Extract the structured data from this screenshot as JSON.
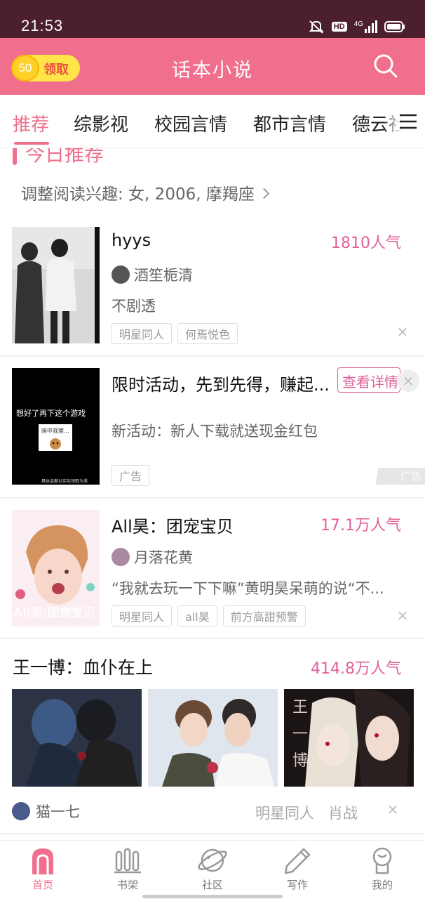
{
  "status_bar": {
    "time": "21:53",
    "hd": "HD",
    "network": "4G",
    "icons": [
      "mute-bell-icon",
      "hd-icon",
      "signal-icon",
      "battery-icon"
    ]
  },
  "header": {
    "coin_amount": "50",
    "coin_label": "领取",
    "title": "话本小说",
    "accent_color": "#f06f8c"
  },
  "tabs": [
    {
      "label": "推荐",
      "active": true
    },
    {
      "label": "综影视",
      "active": false
    },
    {
      "label": "校园言情",
      "active": false
    },
    {
      "label": "都市言情",
      "active": false
    },
    {
      "label": "德云社",
      "active": false
    }
  ],
  "section": {
    "title": "今日推荐",
    "interest": "调整阅读兴趣: 女, 2006, 摩羯座"
  },
  "books": [
    {
      "title": "hyys",
      "popularity": "1810人气",
      "author": "酒笙栀清",
      "description": "不剧透",
      "tags": [
        "明星同人",
        "何焉悦色"
      ]
    },
    {
      "title": "All昊：团宠宝贝",
      "popularity": "17.1万人气",
      "author": "月落花黄",
      "description": "“我就去玩一下下嘛”黄明昊呆萌的说“不...",
      "tags": [
        "明星同人",
        "all昊",
        "前方高甜预警"
      ],
      "cover_text": "All昊:团宠宝贝"
    }
  ],
  "ad": {
    "title": "限时活动，先到先得，赚起...",
    "button_label": "查看详情",
    "description": "新活动：新人下载就送现金红包",
    "tag": "广告",
    "badge": "广告",
    "cover_text": "想好了再下这个游戏",
    "cover_sub": "暗中观察...",
    "cover_note": "具体金额以实际领取为准"
  },
  "featured": {
    "title": "王一博：血仆在上",
    "popularity": "414.8万人气",
    "author": "猫一七",
    "tags": [
      "明星同人",
      "肖战"
    ],
    "image3_text": "王一博"
  },
  "bottom_nav": [
    {
      "label": "首页",
      "icon": "home-icon",
      "active": true
    },
    {
      "label": "书架",
      "icon": "bookshelf-icon",
      "active": false
    },
    {
      "label": "社区",
      "icon": "planet-icon",
      "active": false
    },
    {
      "label": "写作",
      "icon": "pen-icon",
      "active": false
    },
    {
      "label": "我的",
      "icon": "profile-icon",
      "active": false
    }
  ],
  "close_symbol": "×"
}
